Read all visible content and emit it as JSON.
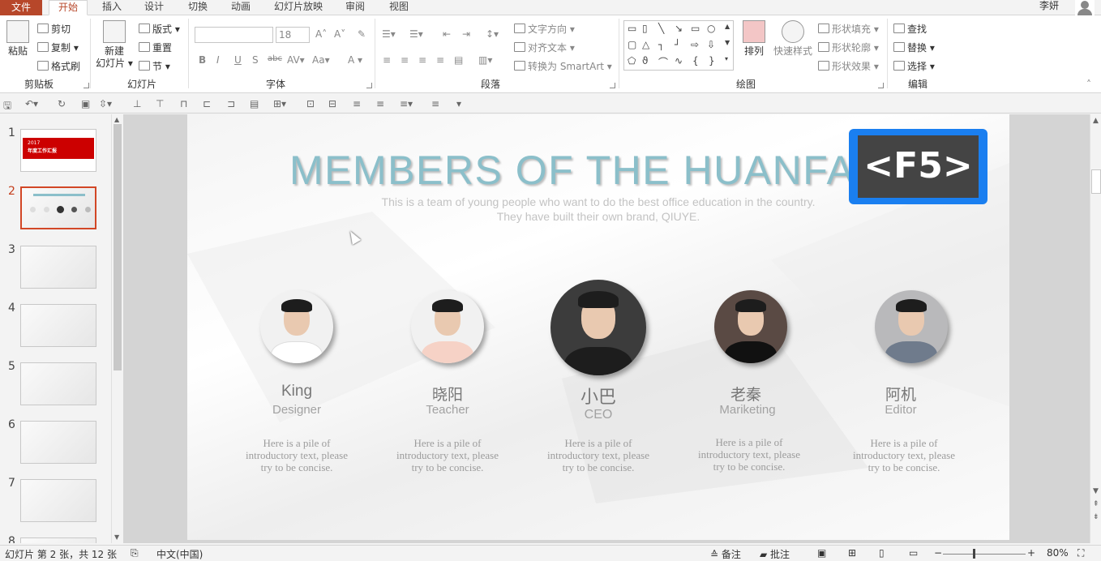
{
  "tabs": [
    {
      "label": "文件",
      "active": false
    },
    {
      "label": "开始",
      "active": true
    },
    {
      "label": "插入",
      "active": false
    },
    {
      "label": "设计",
      "active": false
    },
    {
      "label": "切换",
      "active": false
    },
    {
      "label": "动画",
      "active": false
    },
    {
      "label": "幻灯片放映",
      "active": false
    },
    {
      "label": "审阅",
      "active": false
    },
    {
      "label": "视图",
      "active": false
    }
  ],
  "user": {
    "name": "李妍"
  },
  "ribbon": {
    "clipboard": {
      "paste": "粘贴",
      "cut": "剪切",
      "copy": "复制",
      "format_painter": "格式刷",
      "group": "剪贴板"
    },
    "slides": {
      "new_slide_line1": "新建",
      "new_slide_line2": "幻灯片",
      "layout": "版式",
      "reset": "重置",
      "section": "节",
      "group": "幻灯片"
    },
    "font": {
      "size": "18",
      "group": "字体"
    },
    "paragraph": {
      "text_direction": "文字方向",
      "align_text": "对齐文本",
      "smartart": "转换为 SmartArt",
      "group": "段落"
    },
    "drawing": {
      "arrange": "排列",
      "quick_styles": "快速样式",
      "shape_fill": "形状填充",
      "shape_outline": "形状轮廓",
      "shape_effects": "形状效果",
      "group": "绘图"
    },
    "editing": {
      "find": "查找",
      "replace": "替换",
      "select": "选择",
      "group": "编辑"
    }
  },
  "thumbnails": [
    {
      "num": "1",
      "current": false,
      "title_line1": "2017",
      "title_line2": "年度工作汇报"
    },
    {
      "num": "2",
      "current": true
    },
    {
      "num": "3",
      "current": false
    },
    {
      "num": "4",
      "current": false
    },
    {
      "num": "5",
      "current": false
    },
    {
      "num": "6",
      "current": false
    },
    {
      "num": "7",
      "current": false
    },
    {
      "num": "8",
      "current": false
    }
  ],
  "slide": {
    "title": "MEMBERS OF THE HUANFA",
    "subtitle_line1": "This is a team of young people who want to do the best office education in the country.",
    "subtitle_line2": "They have built their own brand, QIUYE.",
    "members": [
      {
        "name": "King",
        "role": "Designer",
        "desc_line1": "Here is a pile of",
        "desc_line2": "introductory text, please",
        "desc_line3": "try to be concise."
      },
      {
        "name": "晓阳",
        "role": "Teacher",
        "desc_line1": "Here is a pile of",
        "desc_line2": "introductory text, please",
        "desc_line3": "try to be concise."
      },
      {
        "name": "小巴",
        "role": "CEO",
        "desc_line1": "Here is a pile of",
        "desc_line2": "introductory text, please",
        "desc_line3": "try to be concise."
      },
      {
        "name": "老秦",
        "role": "Mariketing",
        "desc_line1": "Here is a pile of",
        "desc_line2": "introductory text, please",
        "desc_line3": "try to be concise."
      },
      {
        "name": "阿机",
        "role": "Editor",
        "desc_line1": "Here is a pile of",
        "desc_line2": "introductory text, please",
        "desc_line3": "try to be concise."
      }
    ]
  },
  "key_badge": "<F5>",
  "status": {
    "slide_info": "幻灯片 第 2 张，共 12 张",
    "language": "中文(中国)",
    "notes": "备注",
    "comments": "批注",
    "zoom": "80%"
  },
  "colors": {
    "accent": "#b7472a",
    "title": "#8bbfca",
    "badge": "#1a7ff0"
  }
}
